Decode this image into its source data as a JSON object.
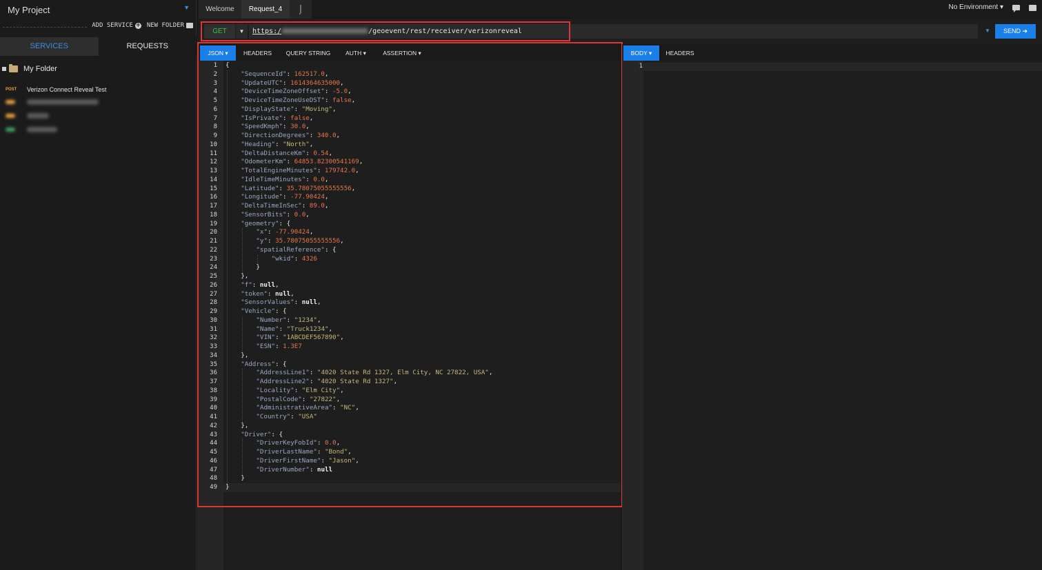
{
  "sidebar": {
    "project_name": "My Project",
    "add_service_label": "ADD SERVICE",
    "new_folder_label": "NEW FOLDER",
    "tabs": [
      "SERVICES",
      "REQUESTS"
    ],
    "folder_name": "My Folder",
    "request_method": "POST",
    "request_name": "Verizon Connect Reveal Test",
    "blurred_items": [
      {
        "color": "#e8a33a"
      },
      {
        "color": "#e8a33a"
      },
      {
        "color": "#3aa860"
      }
    ]
  },
  "tabs": {
    "welcome": "Welcome",
    "request": "Request_4",
    "new_tab_icon": "new-tab-icon"
  },
  "environment": {
    "label": "No Environment"
  },
  "request": {
    "method": "GET",
    "url_scheme": "https:/",
    "url_path": "/geoevent/rest/receiver/verizonreveal",
    "send_label": "SEND"
  },
  "request_tabs": [
    "JSON",
    "HEADERS",
    "QUERY STRING",
    "AUTH",
    "ASSERTION"
  ],
  "response_tabs": [
    "BODY",
    "HEADERS"
  ],
  "response_line_number": "1",
  "colors": {
    "accent": "#1a7fe8",
    "method_get": "#35c24a",
    "highlight_border": "#e03535",
    "json_key": "#9aa8c6",
    "json_string": "#c6b97a",
    "json_number": "#e8764a"
  },
  "json_body_lines": [
    [
      [
        "p",
        "{"
      ]
    ],
    [
      [
        "k",
        "\"SequenceId\""
      ],
      [
        "p",
        ": "
      ],
      [
        "n",
        "162517.0"
      ],
      [
        "p",
        ","
      ]
    ],
    [
      [
        "k",
        "\"UpdateUTC\""
      ],
      [
        "p",
        ": "
      ],
      [
        "n",
        "1614364635000"
      ],
      [
        "p",
        ","
      ]
    ],
    [
      [
        "k",
        "\"DeviceTimeZoneOffset\""
      ],
      [
        "p",
        ": "
      ],
      [
        "n",
        "-5.0"
      ],
      [
        "p",
        ","
      ]
    ],
    [
      [
        "k",
        "\"DeviceTimeZoneUseDST\""
      ],
      [
        "p",
        ": "
      ],
      [
        "n",
        "false"
      ],
      [
        "p",
        ","
      ]
    ],
    [
      [
        "k",
        "\"DisplayState\""
      ],
      [
        "p",
        ": "
      ],
      [
        "s",
        "\"Moving\""
      ],
      [
        "p",
        ","
      ]
    ],
    [
      [
        "k",
        "\"IsPrivate\""
      ],
      [
        "p",
        ": "
      ],
      [
        "n",
        "false"
      ],
      [
        "p",
        ","
      ]
    ],
    [
      [
        "k",
        "\"SpeedKmph\""
      ],
      [
        "p",
        ": "
      ],
      [
        "n",
        "30.0"
      ],
      [
        "p",
        ","
      ]
    ],
    [
      [
        "k",
        "\"DirectionDegrees\""
      ],
      [
        "p",
        ": "
      ],
      [
        "n",
        "340.0"
      ],
      [
        "p",
        ","
      ]
    ],
    [
      [
        "k",
        "\"Heading\""
      ],
      [
        "p",
        ": "
      ],
      [
        "s",
        "\"North\""
      ],
      [
        "p",
        ","
      ]
    ],
    [
      [
        "k",
        "\"DeltaDistanceKm\""
      ],
      [
        "p",
        ": "
      ],
      [
        "n",
        "0.54"
      ],
      [
        "p",
        ","
      ]
    ],
    [
      [
        "k",
        "\"OdometerKm\""
      ],
      [
        "p",
        ": "
      ],
      [
        "n",
        "64853.82300541169"
      ],
      [
        "p",
        ","
      ]
    ],
    [
      [
        "k",
        "\"TotalEngineMinutes\""
      ],
      [
        "p",
        ": "
      ],
      [
        "n",
        "179742.0"
      ],
      [
        "p",
        ","
      ]
    ],
    [
      [
        "k",
        "\"IdleTimeMinutes\""
      ],
      [
        "p",
        ": "
      ],
      [
        "n",
        "0.0"
      ],
      [
        "p",
        ","
      ]
    ],
    [
      [
        "k",
        "\"Latitude\""
      ],
      [
        "p",
        ": "
      ],
      [
        "n",
        "35.78075055555556"
      ],
      [
        "p",
        ","
      ]
    ],
    [
      [
        "k",
        "\"Longitude\""
      ],
      [
        "p",
        ": "
      ],
      [
        "n",
        "-77.90424"
      ],
      [
        "p",
        ","
      ]
    ],
    [
      [
        "k",
        "\"DeltaTimeInSec\""
      ],
      [
        "p",
        ": "
      ],
      [
        "n",
        "89.0"
      ],
      [
        "p",
        ","
      ]
    ],
    [
      [
        "k",
        "\"SensorBits\""
      ],
      [
        "p",
        ": "
      ],
      [
        "n",
        "0.0"
      ],
      [
        "p",
        ","
      ]
    ],
    [
      [
        "k",
        "\"geometry\""
      ],
      [
        "p",
        ": {"
      ]
    ],
    [
      [
        "k",
        "\"x\""
      ],
      [
        "p",
        ": "
      ],
      [
        "n",
        "-77.90424"
      ],
      [
        "p",
        ","
      ]
    ],
    [
      [
        "k",
        "\"y\""
      ],
      [
        "p",
        ": "
      ],
      [
        "n",
        "35.78075055555556"
      ],
      [
        "p",
        ","
      ]
    ],
    [
      [
        "k",
        "\"spatialReference\""
      ],
      [
        "p",
        ": {"
      ]
    ],
    [
      [
        "k",
        "\"wkid\""
      ],
      [
        "p",
        ": "
      ],
      [
        "n",
        "4326"
      ]
    ],
    [
      [
        "p",
        "}"
      ]
    ],
    [
      [
        "p",
        "},"
      ]
    ],
    [
      [
        "k",
        "\"f\""
      ],
      [
        "p",
        ": "
      ],
      [
        "z",
        "null"
      ],
      [
        "p",
        ","
      ]
    ],
    [
      [
        "k",
        "\"token\""
      ],
      [
        "p",
        ": "
      ],
      [
        "z",
        "null"
      ],
      [
        "p",
        ","
      ]
    ],
    [
      [
        "k",
        "\"SensorValues\""
      ],
      [
        "p",
        ": "
      ],
      [
        "z",
        "null"
      ],
      [
        "p",
        ","
      ]
    ],
    [
      [
        "k",
        "\"Vehicle\""
      ],
      [
        "p",
        ": {"
      ]
    ],
    [
      [
        "k",
        "\"Number\""
      ],
      [
        "p",
        ": "
      ],
      [
        "s",
        "\"1234\""
      ],
      [
        "p",
        ","
      ]
    ],
    [
      [
        "k",
        "\"Name\""
      ],
      [
        "p",
        ": "
      ],
      [
        "s",
        "\"Truck1234\""
      ],
      [
        "p",
        ","
      ]
    ],
    [
      [
        "k",
        "\"VIN\""
      ],
      [
        "p",
        ": "
      ],
      [
        "s",
        "\"1ABCDEF567890\""
      ],
      [
        "p",
        ","
      ]
    ],
    [
      [
        "k",
        "\"ESN\""
      ],
      [
        "p",
        ": "
      ],
      [
        "n",
        "1.3E7"
      ]
    ],
    [
      [
        "p",
        "},"
      ]
    ],
    [
      [
        "k",
        "\"Address\""
      ],
      [
        "p",
        ": {"
      ]
    ],
    [
      [
        "k",
        "\"AddressLine1\""
      ],
      [
        "p",
        ": "
      ],
      [
        "s",
        "\"4020 State Rd 1327, Elm City, NC 27822, USA\""
      ],
      [
        "p",
        ","
      ]
    ],
    [
      [
        "k",
        "\"AddressLine2\""
      ],
      [
        "p",
        ": "
      ],
      [
        "s",
        "\"4020 State Rd 1327\""
      ],
      [
        "p",
        ","
      ]
    ],
    [
      [
        "k",
        "\"Locality\""
      ],
      [
        "p",
        ": "
      ],
      [
        "s",
        "\"Elm City\""
      ],
      [
        "p",
        ","
      ]
    ],
    [
      [
        "k",
        "\"PostalCode\""
      ],
      [
        "p",
        ": "
      ],
      [
        "s",
        "\"27822\""
      ],
      [
        "p",
        ","
      ]
    ],
    [
      [
        "k",
        "\"AdministrativeArea\""
      ],
      [
        "p",
        ": "
      ],
      [
        "s",
        "\"NC\""
      ],
      [
        "p",
        ","
      ]
    ],
    [
      [
        "k",
        "\"Country\""
      ],
      [
        "p",
        ": "
      ],
      [
        "s",
        "\"USA\""
      ]
    ],
    [
      [
        "p",
        "},"
      ]
    ],
    [
      [
        "k",
        "\"Driver\""
      ],
      [
        "p",
        ": {"
      ]
    ],
    [
      [
        "k",
        "\"DriverKeyFobId\""
      ],
      [
        "p",
        ": "
      ],
      [
        "n",
        "0.0"
      ],
      [
        "p",
        ","
      ]
    ],
    [
      [
        "k",
        "\"DriverLastName\""
      ],
      [
        "p",
        ": "
      ],
      [
        "s",
        "\"Bond\""
      ],
      [
        "p",
        ","
      ]
    ],
    [
      [
        "k",
        "\"DriverFirstName\""
      ],
      [
        "p",
        ": "
      ],
      [
        "s",
        "\"Jason\""
      ],
      [
        "p",
        ","
      ]
    ],
    [
      [
        "k",
        "\"DriverNumber\""
      ],
      [
        "p",
        ": "
      ],
      [
        "z",
        "null"
      ]
    ],
    [
      [
        "p",
        "}"
      ]
    ],
    [
      [
        "p",
        "}"
      ]
    ]
  ]
}
